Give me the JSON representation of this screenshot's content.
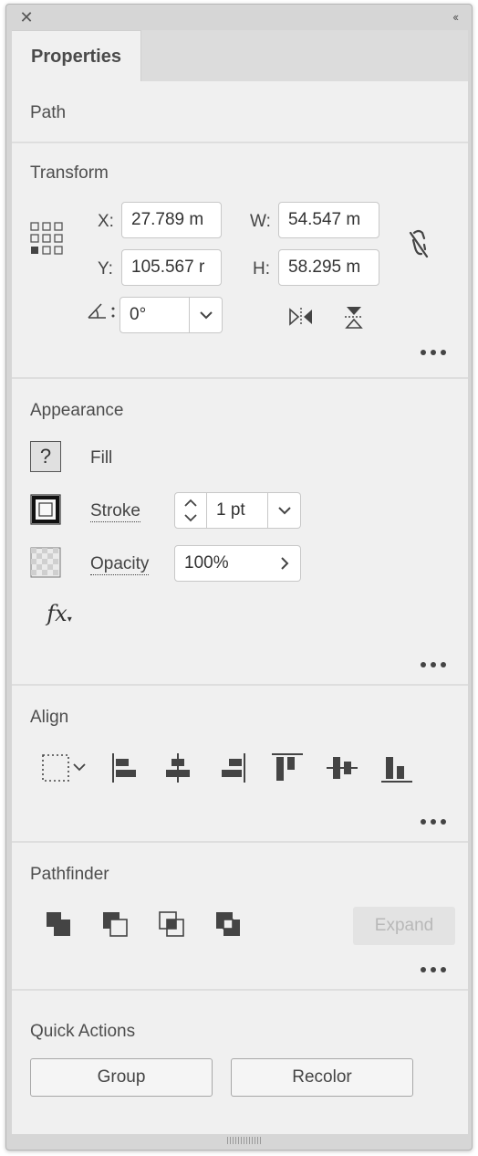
{
  "titlebar": {
    "close_icon": "close-x-icon",
    "collapse_icon": "double-chevron-left-icon",
    "collapse_label": "‹‹"
  },
  "tabs": [
    {
      "label": "Properties",
      "active": true
    }
  ],
  "selection_type": "Path",
  "transform": {
    "title": "Transform",
    "x_label": "X:",
    "x_value": "27.789 m",
    "y_label": "Y:",
    "y_value": "105.567 r",
    "w_label": "W:",
    "w_value": "54.547 m",
    "h_label": "H:",
    "h_value": "58.295 m",
    "rotate_value": "0°",
    "constrain_icon": "broken-link-icon",
    "flip_horizontal_icon": "flip-horizontal-icon",
    "flip_vertical_icon": "flip-vertical-icon"
  },
  "appearance": {
    "title": "Appearance",
    "fill_label": "Fill",
    "fill_swatch_text": "?",
    "stroke_label": "Stroke",
    "stroke_value": "1 pt",
    "opacity_label": "Opacity",
    "opacity_value": "100%",
    "fx_label": "fx"
  },
  "align": {
    "title": "Align",
    "icons": [
      "align-to-selection-icon",
      "align-left-icon",
      "align-horizontal-center-icon",
      "align-right-icon",
      "align-top-icon",
      "align-vertical-center-icon",
      "align-bottom-icon"
    ]
  },
  "pathfinder": {
    "title": "Pathfinder",
    "icons": [
      "unite-icon",
      "minus-front-icon",
      "intersect-icon",
      "exclude-icon"
    ],
    "expand_label": "Expand"
  },
  "quick_actions": {
    "title": "Quick Actions",
    "group_label": "Group",
    "recolor_label": "Recolor"
  },
  "colors": {
    "panel_bg": "#f0f0f0",
    "frame_bg": "#d6d6d6",
    "text": "#4a4a4a",
    "divider": "#dedede"
  }
}
